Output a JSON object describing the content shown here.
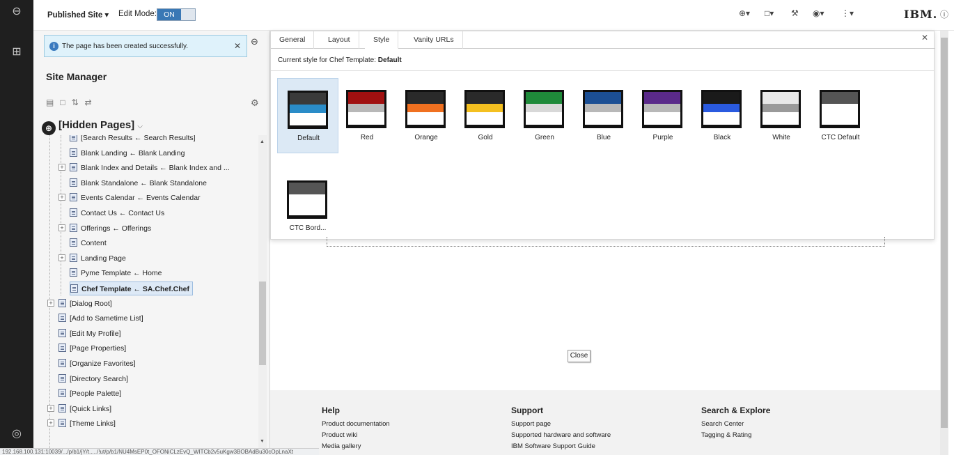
{
  "topbar": {
    "site_label": "Published Site ▾",
    "edit_mode_label": "Edit Mode:",
    "toggle_on": "ON",
    "brand": "IBM."
  },
  "notice": {
    "message": "The page has been created successfully."
  },
  "site_manager": {
    "title": "Site Manager",
    "root": "[Hidden Pages]",
    "tree": [
      {
        "label": "[Search Results ← Search Results]",
        "depth": 2,
        "expand": false
      },
      {
        "label": "Blank Landing ← Blank Landing",
        "depth": 2,
        "expand": false
      },
      {
        "label": "Blank Index and Details ← Blank Index and ...",
        "depth": 2,
        "expand": true
      },
      {
        "label": "Blank Standalone ← Blank Standalone",
        "depth": 2,
        "expand": false
      },
      {
        "label": "Events Calendar ← Events Calendar",
        "depth": 2,
        "expand": true
      },
      {
        "label": "Contact Us ← Contact Us",
        "depth": 2,
        "expand": false
      },
      {
        "label": "Offerings ← Offerings",
        "depth": 2,
        "expand": true
      },
      {
        "label": "Content",
        "depth": 2,
        "expand": false
      },
      {
        "label": "Landing Page",
        "depth": 2,
        "expand": true
      },
      {
        "label": "Pyme Template ← Home",
        "depth": 2,
        "expand": false
      },
      {
        "label": "Chef Template ← SA.Chef.Chef",
        "depth": 2,
        "expand": false,
        "selected": true
      },
      {
        "label": "[Dialog Root]",
        "depth": 1,
        "expand": true
      },
      {
        "label": "[Add to Sametime List]",
        "depth": 1,
        "expand": false
      },
      {
        "label": "[Edit My Profile]",
        "depth": 1,
        "expand": false
      },
      {
        "label": "[Page Properties]",
        "depth": 1,
        "expand": false
      },
      {
        "label": "[Organize Favorites]",
        "depth": 1,
        "expand": false
      },
      {
        "label": "[Directory Search]",
        "depth": 1,
        "expand": false
      },
      {
        "label": "[People Palette]",
        "depth": 1,
        "expand": false
      },
      {
        "label": "[Quick Links]",
        "depth": 1,
        "expand": true
      },
      {
        "label": "[Theme Links]",
        "depth": 1,
        "expand": true
      }
    ]
  },
  "dialog": {
    "tabs": [
      "General",
      "Layout",
      "Style",
      "Vanity URLs"
    ],
    "active_tab": "Style",
    "current_style_label": "Current style for Chef Template:",
    "current_style_value": "Default",
    "styles": [
      {
        "name": "Default",
        "top": "#3a3a3a",
        "accent": "#2a8cc8",
        "selected": true
      },
      {
        "name": "Red",
        "top": "#a01010",
        "accent": "#b8b8b8"
      },
      {
        "name": "Orange",
        "top": "#2a2a2a",
        "accent": "#f07020"
      },
      {
        "name": "Gold",
        "top": "#2a2a2a",
        "accent": "#f4c020"
      },
      {
        "name": "Green",
        "top": "#1f8a3a",
        "accent": "#d8d8d8"
      },
      {
        "name": "Blue",
        "top": "#1c4f94",
        "accent": "#b8b8b8"
      },
      {
        "name": "Purple",
        "top": "#5a2a8a",
        "accent": "#b8b8b8"
      },
      {
        "name": "Black",
        "top": "#1a1a1a",
        "accent": "#2a5adf"
      },
      {
        "name": "White",
        "top": "#e8e8e8",
        "accent": "#9a9a9a"
      },
      {
        "name": "CTC Default",
        "top": "#555555",
        "accent": "#ffffff"
      },
      {
        "name": "CTC Bord...",
        "top": "#555555",
        "accent": "#ffffff"
      }
    ]
  },
  "page": {
    "close_button": "Close"
  },
  "footer": {
    "columns": [
      {
        "title": "Help",
        "links": [
          "Product documentation",
          "Product wiki",
          "Media gallery"
        ]
      },
      {
        "title": "Support",
        "links": [
          "Support page",
          "Supported hardware and software",
          "IBM Software Support Guide"
        ]
      },
      {
        "title": "Search & Explore",
        "links": [
          "Search Center",
          "Tagging & Rating"
        ]
      }
    ]
  },
  "status_url": "192.168.100.131:10039/.../p/b1/jY/t...../!ut/p/b1/NU4MsEP0t_OFONiCLzEvQ_WITCb2v5uKgw3BOBAdBu30cOpLnaXt"
}
